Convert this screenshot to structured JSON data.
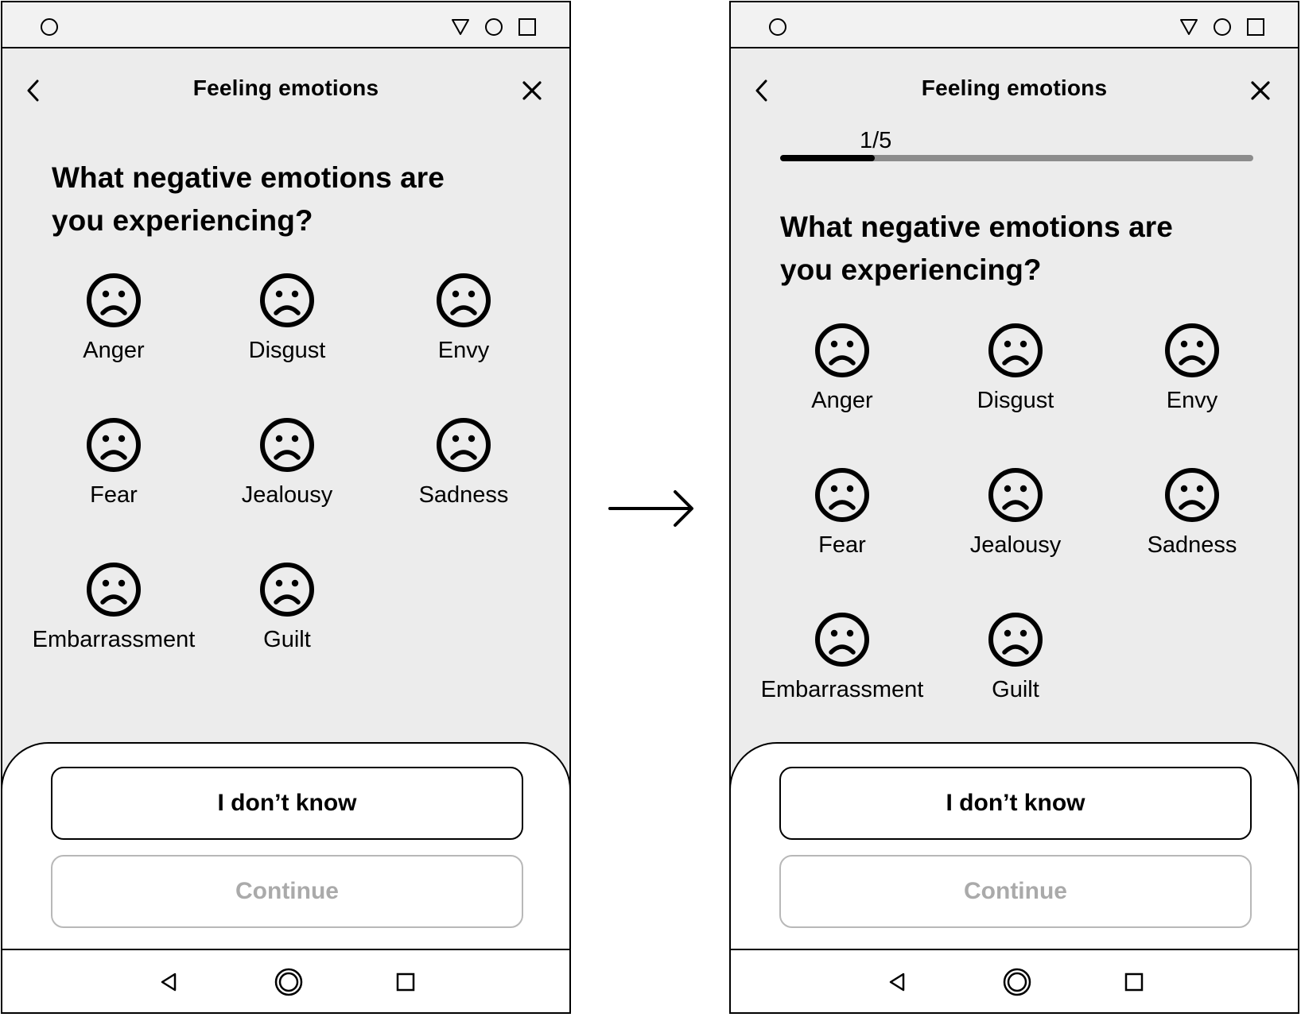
{
  "screens": [
    {
      "id": "before",
      "title": "Feeling emotions",
      "question": "What negative emotions are you experiencing?",
      "show_progress": false,
      "emotions": [
        "Anger",
        "Disgust",
        "Envy",
        "Fear",
        "Jealousy",
        "Sadness",
        "Embarrassment",
        "Guilt"
      ],
      "buttons": {
        "dont_know": "I don’t know",
        "continue": "Continue"
      }
    },
    {
      "id": "after",
      "title": "Feeling emotions",
      "progress": {
        "text": "1/5",
        "current": 1,
        "total": 5
      },
      "show_progress": true,
      "question": "What negative emotions are you experiencing?",
      "emotions": [
        "Anger",
        "Disgust",
        "Envy",
        "Fear",
        "Jealousy",
        "Sadness",
        "Embarrassment",
        "Guilt"
      ],
      "buttons": {
        "dont_know": "I don’t know",
        "continue": "Continue"
      }
    }
  ],
  "icons": {
    "status_bar": [
      "camera-icon",
      "signal-icon",
      "battery-icon",
      "square-icon"
    ],
    "app_bar": [
      "back-icon",
      "close-icon"
    ],
    "emotion": "sad-face-icon",
    "nav_bar": [
      "nav-back-icon",
      "nav-home-icon",
      "nav-recents-icon"
    ],
    "transition": "arrow-right-icon"
  },
  "colors": {
    "screen_bg": "#ececec",
    "sheet_bg": "#ffffff",
    "progress_track": "#8c8c8c",
    "progress_fill": "#000000",
    "disabled_text": "#aaaaaa"
  }
}
